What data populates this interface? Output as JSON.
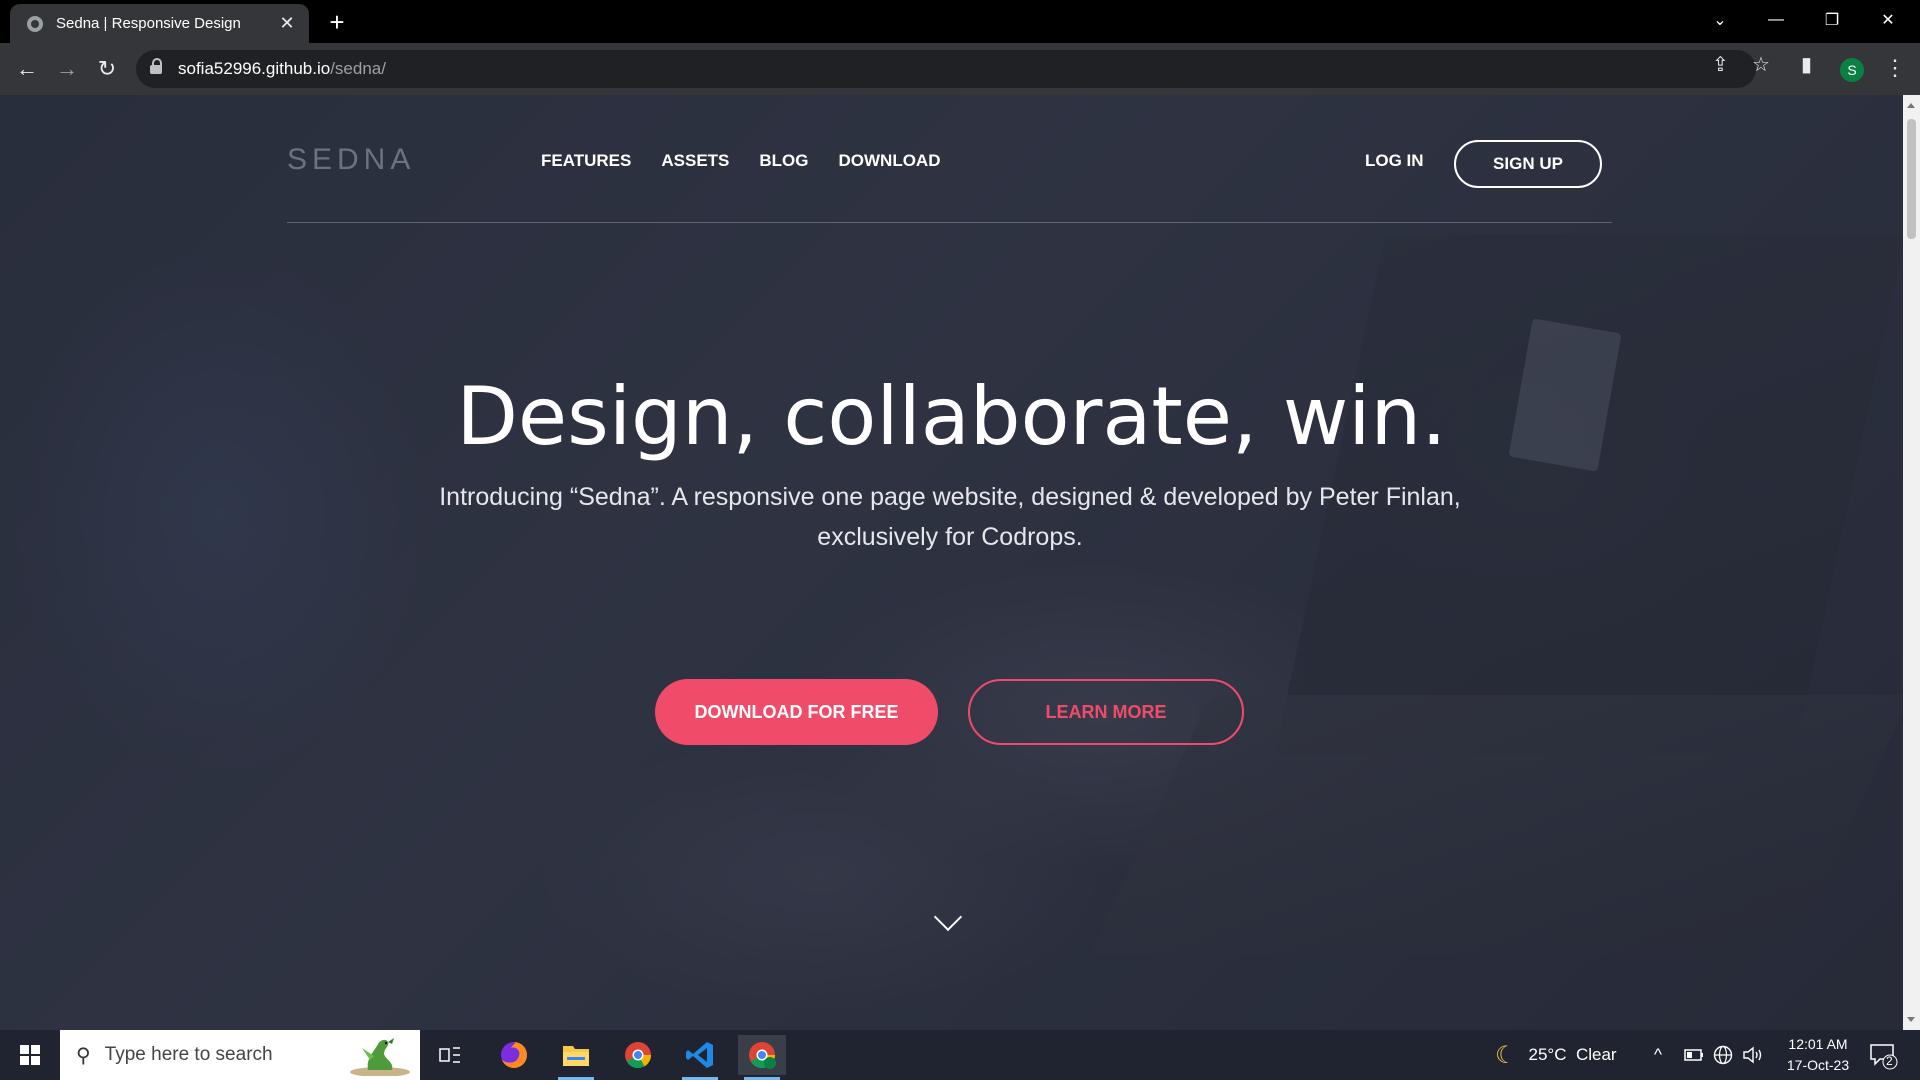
{
  "browser": {
    "tab_title": "Sedna | Responsive Design",
    "new_tab_label": "+",
    "url_host": "sofia52996.github.io",
    "url_path": "/sedna/",
    "profile_initial": "S"
  },
  "site": {
    "logo": "SEDNA",
    "nav": [
      "FEATURES",
      "ASSETS",
      "BLOG",
      "DOWNLOAD"
    ],
    "login": "LOG IN",
    "signup": "SIGN UP"
  },
  "hero": {
    "headline": "Design, collaborate, win.",
    "subtext": "Introducing “Sedna”. A responsive one page website, designed & developed by Peter Finlan, exclusively for Codrops.",
    "primary_button": "DOWNLOAD FOR FREE",
    "secondary_button": "LEARN MORE"
  },
  "colors": {
    "accent": "#f14b6a",
    "browser_bg": "#35363a"
  },
  "taskbar": {
    "search_placeholder": "Type here to search",
    "weather": "25°C  Clear",
    "time": "12:01 AM",
    "date": "17-Oct-23",
    "notification_count": "2"
  }
}
